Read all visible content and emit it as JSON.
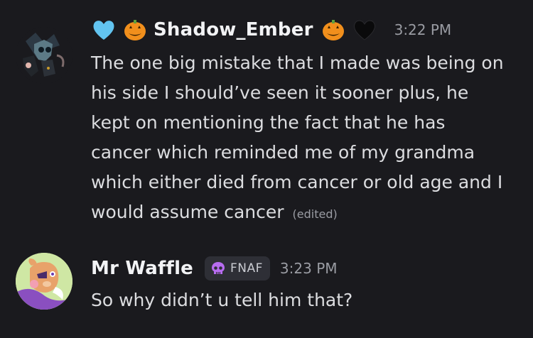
{
  "messages": [
    {
      "username": "Shadow_Ember",
      "timestamp": "3:22 PM",
      "text": "The one big mistake that I made was being on his side I should’ve seen it sooner plus, he kept on mentioning the fact that he has cancer which reminded me of my grandma which either died from cancer or old age and I would assume cancer",
      "edited_label": "(edited)",
      "name_decorations": [
        "light-blue-heart-icon",
        "jack-o-lantern-icon",
        "jack-o-lantern-icon",
        "black-heart-icon"
      ]
    },
    {
      "username": "Mr Waffle",
      "timestamp": "3:23 PM",
      "tag": {
        "icon": "purple-skull-icon",
        "label": "FNAF"
      },
      "text": "So why didn’t u tell him that?"
    }
  ],
  "colors": {
    "background": "#1a1a1e",
    "username": "#f2f3f5",
    "message_text": "#dcdde0",
    "timestamp": "#9a9ca3",
    "tag_background": "#2e2f36"
  }
}
